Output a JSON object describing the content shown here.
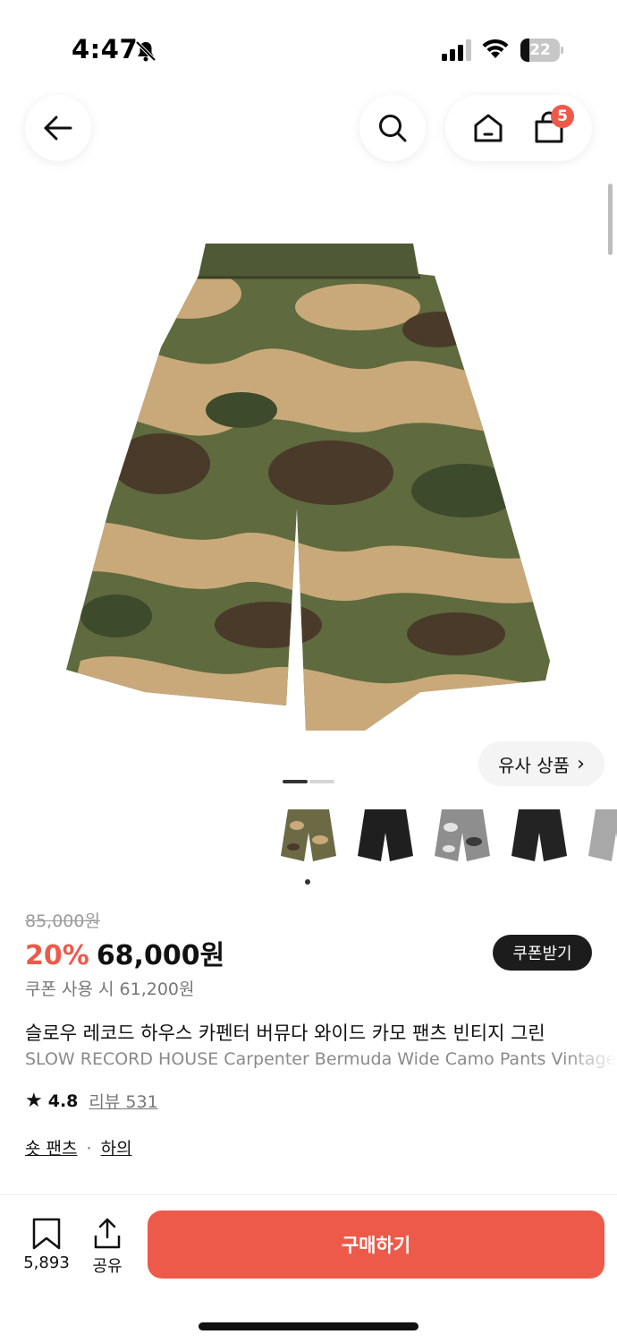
{
  "status_bar": {
    "time": "4:47",
    "battery_level": "22"
  },
  "header": {
    "cart_count": "5"
  },
  "gallery": {
    "similar_label": "유사 상품",
    "image_count": 2,
    "active_index": 0,
    "thumbnails": [
      {
        "name": "camo-green",
        "color": "#6b6a45"
      },
      {
        "name": "black",
        "color": "#1f1f1f"
      },
      {
        "name": "camo-gray",
        "color": "#8e8e8e"
      },
      {
        "name": "black-2",
        "color": "#232323"
      },
      {
        "name": "gray",
        "color": "#a8a8a8"
      }
    ]
  },
  "price": {
    "original": "85,000원",
    "discount": "20%",
    "sale": "68,000원",
    "coupon_button": "쿠폰받기",
    "coupon_note": "쿠폰 사용 시 61,200원"
  },
  "product": {
    "title_ko": "슬로우 레코드 하우스 카펜터 버뮤다 와이드 카모 팬츠 빈티지 그린",
    "title_en": "SLOW RECORD HOUSE Carpenter Bermuda Wide Camo Pants Vintage Green",
    "rating": "4.8",
    "review_label": "리뷰 531",
    "category_1": "숏 팬츠",
    "category_sep": "·",
    "category_2": "하의"
  },
  "bottom_bar": {
    "bookmark_count": "5,893",
    "share_label": "공유",
    "buy_label": "구매하기"
  },
  "colors": {
    "accent": "#ee5a4a",
    "dark": "#1c1c1c"
  }
}
